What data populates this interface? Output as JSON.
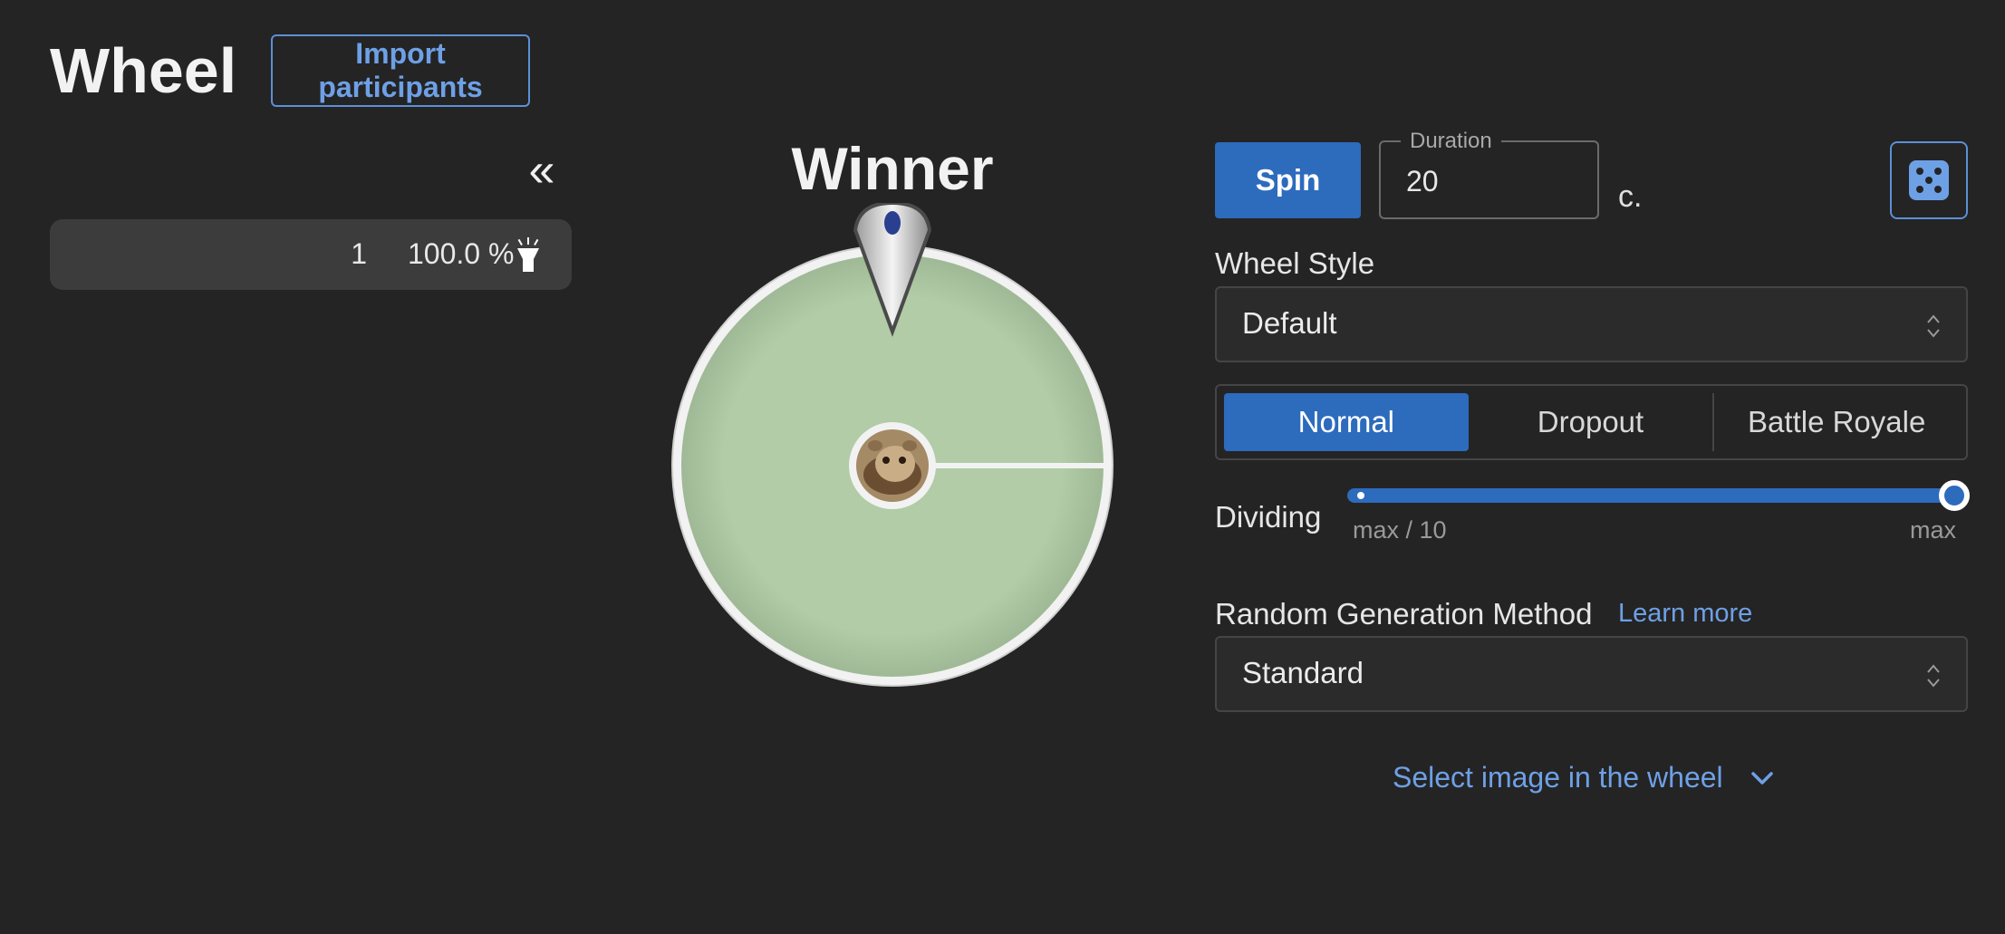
{
  "header": {
    "title": "Wheel",
    "import_label": "Import participants"
  },
  "participants": {
    "collapse_glyph": "«",
    "rows": [
      {
        "count": "1",
        "percent": "100.0 %",
        "icon": "flashlight-icon"
      }
    ]
  },
  "wheel": {
    "title": "Winner",
    "segment_color": "#b1cca6",
    "rim_color": "#f2f2f2",
    "center_icon": "hamster-avatar-icon"
  },
  "controls": {
    "spin_label": "Spin",
    "duration_label": "Duration",
    "duration_value": "20",
    "duration_unit": "c.",
    "random_icon": "dice-icon",
    "wheel_style_label": "Wheel Style",
    "wheel_style_value": "Default",
    "modes": [
      "Normal",
      "Dropout",
      "Battle Royale"
    ],
    "active_mode": "Normal",
    "dividing_label": "Dividing",
    "dividing_min": "max / 10",
    "dividing_max": "max",
    "dividing_value_fraction": 1.0,
    "rgm_label": "Random Generation Method",
    "learn_more": "Learn more",
    "rgm_value": "Standard",
    "select_image_label": "Select image in the wheel"
  },
  "colors": {
    "background": "#242424",
    "accent": "#2d6bbd",
    "link": "#6ea0e6"
  }
}
